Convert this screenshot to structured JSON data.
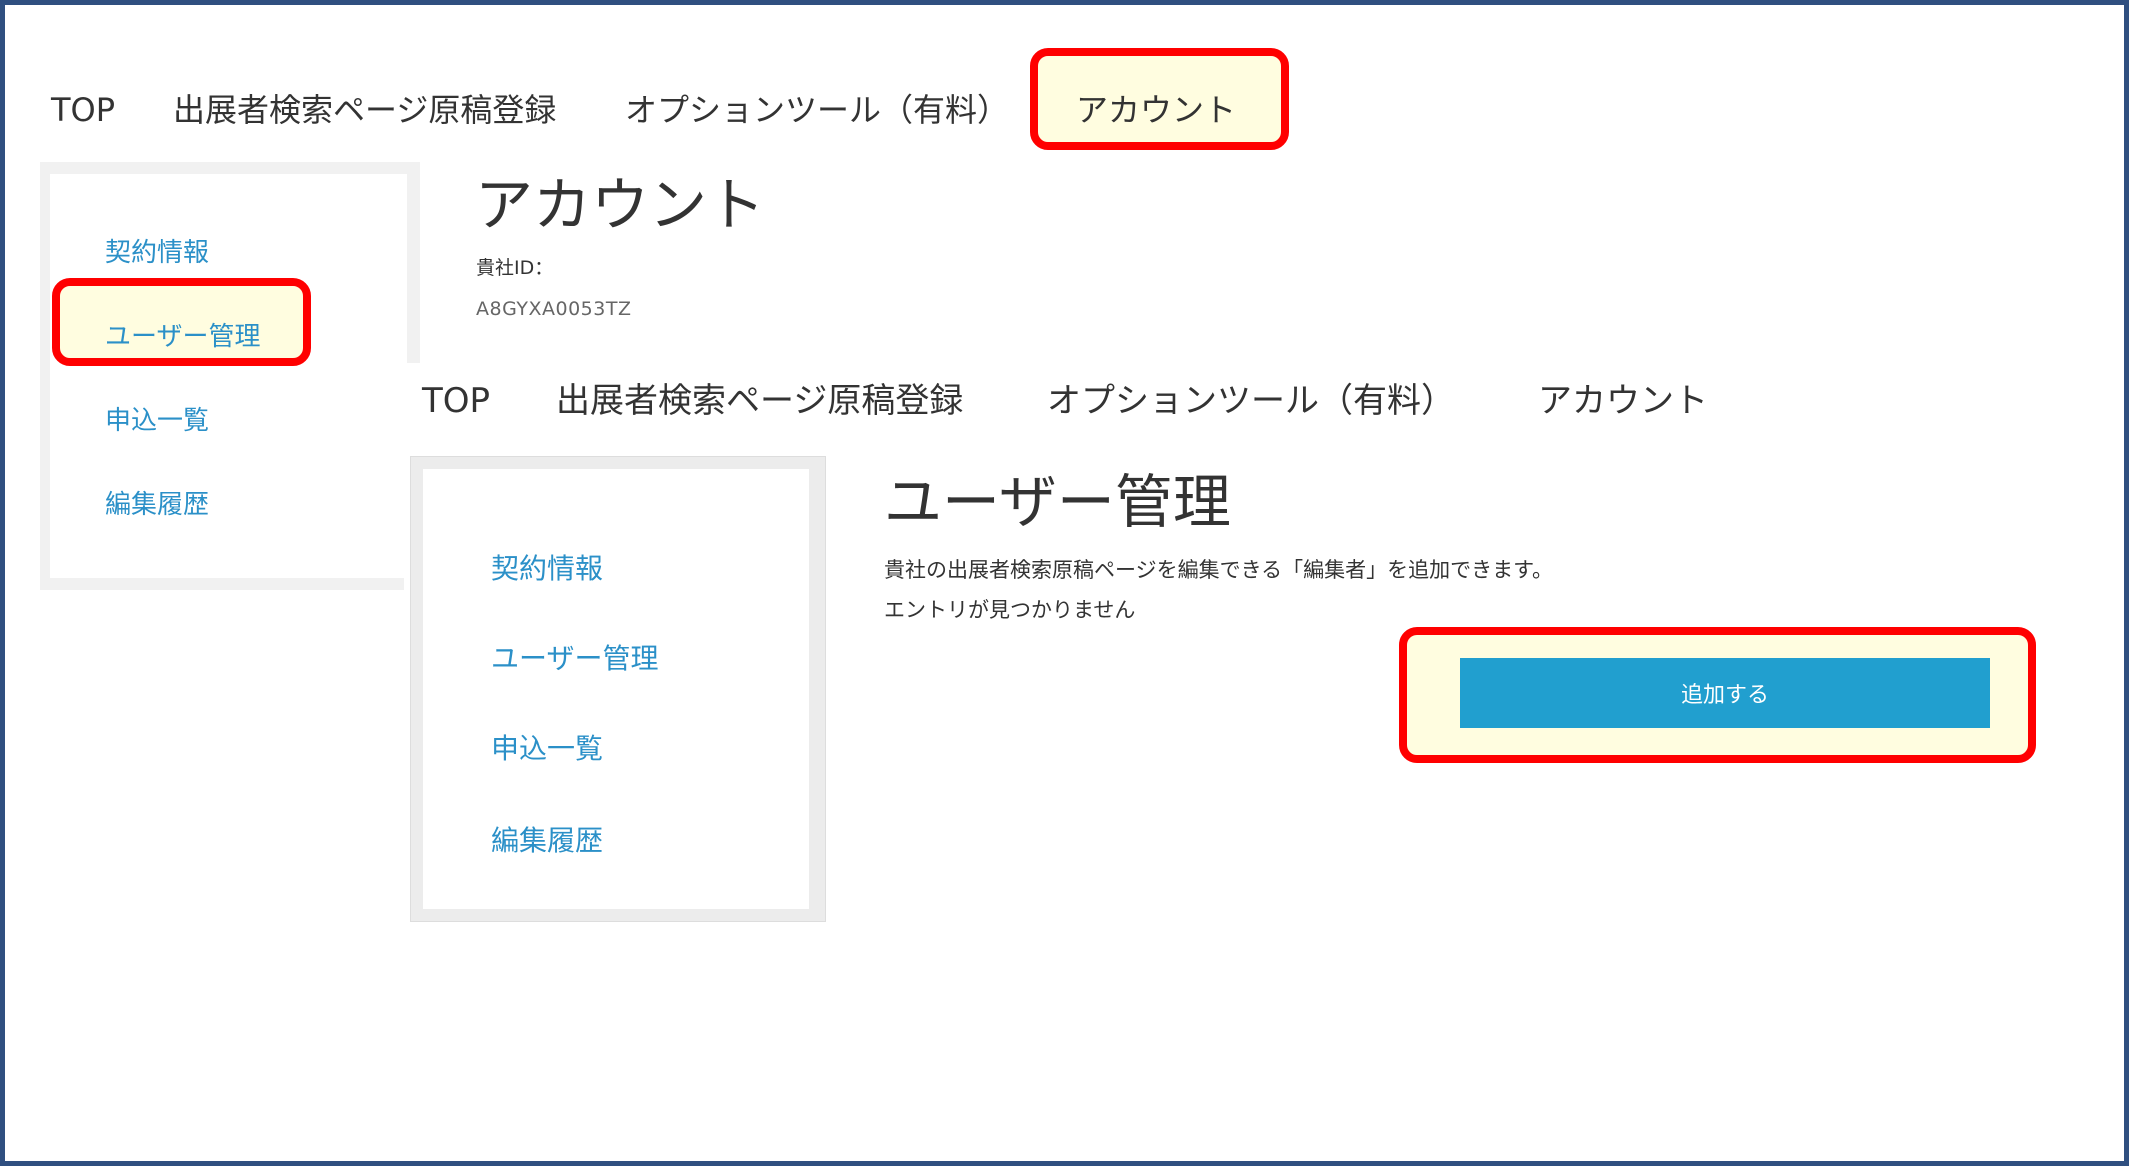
{
  "back_screen": {
    "nav": [
      "TOP",
      "出展者検索ページ原稿登録",
      "オプションツール（有料）",
      "アカウント"
    ],
    "sidebar": [
      "契約情報",
      "ユーザー管理",
      "申込一覧",
      "編集履歴"
    ],
    "page_title": "アカウント",
    "company_id_label": "貴社ID：",
    "company_id_value": "A8GYXA0053TZ"
  },
  "front_screen": {
    "nav": [
      "TOP",
      "出展者検索ページ原稿登録",
      "オプションツール（有料）",
      "アカウント"
    ],
    "sidebar": [
      "契約情報",
      "ユーザー管理",
      "申込一覧",
      "編集履歴"
    ],
    "page_title": "ユーザー管理",
    "description": "貴社の出展者検索原稿ページを編集できる「編集者」を追加できます。",
    "empty_message": "エントリが見つかりません",
    "add_button_label": "追加する"
  },
  "colors": {
    "highlight_border": "#ff0000",
    "highlight_fill": "#fffde0",
    "link": "#2b90c8",
    "button": "#219fcf",
    "frame": "#2f4f80"
  }
}
